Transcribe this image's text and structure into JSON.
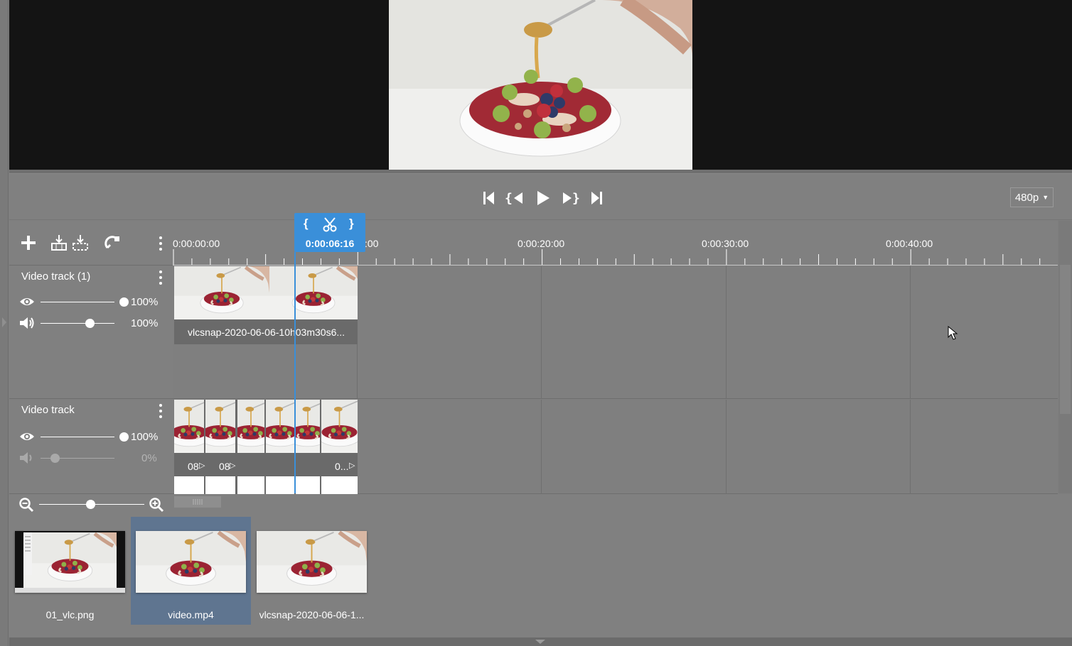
{
  "preview": {
    "image": "fruit-bowl-honey-spoon"
  },
  "transport": {
    "buttons": [
      "go-to-start",
      "previous-mark",
      "play",
      "next-mark",
      "go-to-end"
    ],
    "quality": "480p"
  },
  "playhead": {
    "time": "0:00:06:16"
  },
  "ruler": {
    "labels": [
      "0:00:00:00",
      ":00",
      "0:00:20:00",
      "0:00:30:00",
      "0:00:40:00"
    ]
  },
  "tracks": [
    {
      "title": "Video track (1)",
      "visibility": "100%",
      "volume": "100%",
      "clip_label": "vlcsnap-2020-06-06-10h03m30s6..."
    },
    {
      "title": "Video track",
      "visibility": "100%",
      "volume": "0%",
      "clip_labels": [
        "08",
        "08",
        "0..."
      ]
    }
  ],
  "media_bin": {
    "items": [
      {
        "name": "01_vlc.png",
        "selected": false
      },
      {
        "name": "video.mp4",
        "selected": true
      },
      {
        "name": "vlcsnap-2020-06-06-1...",
        "selected": false
      }
    ]
  },
  "colors": {
    "accent": "#3a8fd9",
    "selection": "#5f7590",
    "panel": "#808080",
    "preview_bg": "#141414"
  }
}
